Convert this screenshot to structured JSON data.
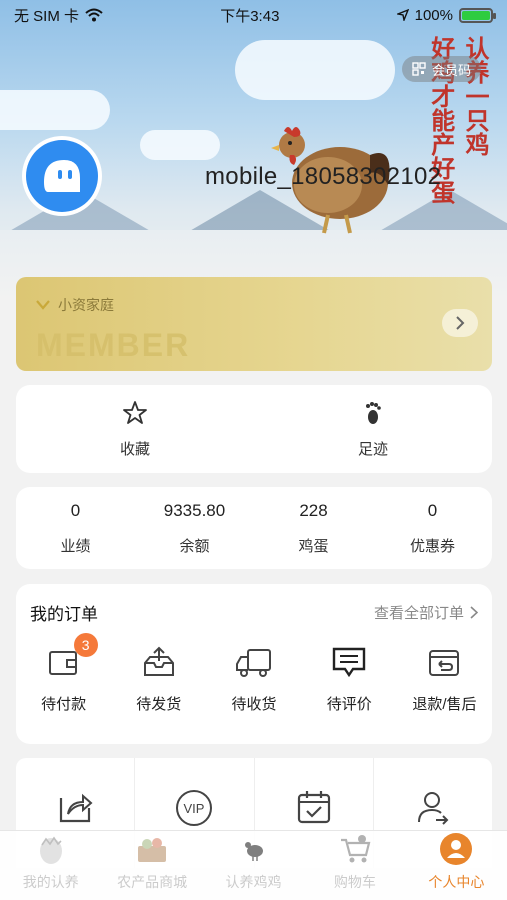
{
  "status_bar": {
    "carrier": "无 SIM 卡",
    "time": "下午3:43",
    "battery": "100%",
    "battery_level": 1.0
  },
  "hero": {
    "member_code_label": "会员码",
    "username": "mobile_18058302102",
    "slogan_columns": [
      "认养一只鸡",
      "好鸡才能产好蛋"
    ]
  },
  "member_card": {
    "level": "小资家庭",
    "watermark": "MEMBER"
  },
  "quick_links": [
    {
      "label": "收藏",
      "icon": "star-icon"
    },
    {
      "label": "足迹",
      "icon": "footprint-icon"
    }
  ],
  "stats": [
    {
      "value": "0",
      "label": "业绩"
    },
    {
      "value": "9335.80",
      "label": "余额"
    },
    {
      "value": "228",
      "label": "鸡蛋"
    },
    {
      "value": "0",
      "label": "优惠券"
    }
  ],
  "orders": {
    "title": "我的订单",
    "view_all": "查看全部订单",
    "items": [
      {
        "label": "待付款",
        "icon": "wallet-icon",
        "badge": "3"
      },
      {
        "label": "待发货",
        "icon": "package-upload-icon"
      },
      {
        "label": "待收货",
        "icon": "delivery-truck-icon"
      },
      {
        "label": "待评价",
        "icon": "comment-icon"
      },
      {
        "label": "退款/售后",
        "icon": "refund-icon"
      }
    ]
  },
  "tools": [
    {
      "icon": "share-icon"
    },
    {
      "icon": "vip-icon",
      "text": "VIP"
    },
    {
      "icon": "calendar-check-icon"
    },
    {
      "icon": "user-share-icon"
    }
  ],
  "tab_bar": [
    {
      "label": "我的认养",
      "icon": "egg-icon"
    },
    {
      "label": "农产品商城",
      "icon": "produce-icon"
    },
    {
      "label": "认养鸡鸡",
      "icon": "chicken-icon"
    },
    {
      "label": "购物车",
      "icon": "cart-icon"
    },
    {
      "label": "个人中心",
      "icon": "user-icon",
      "active": true
    }
  ],
  "colors": {
    "accent": "#e8852c",
    "badge": "#f5793a",
    "slogan": "#c0342b",
    "avatar": "#2f8cf0",
    "member_gold": "#dcc673"
  }
}
